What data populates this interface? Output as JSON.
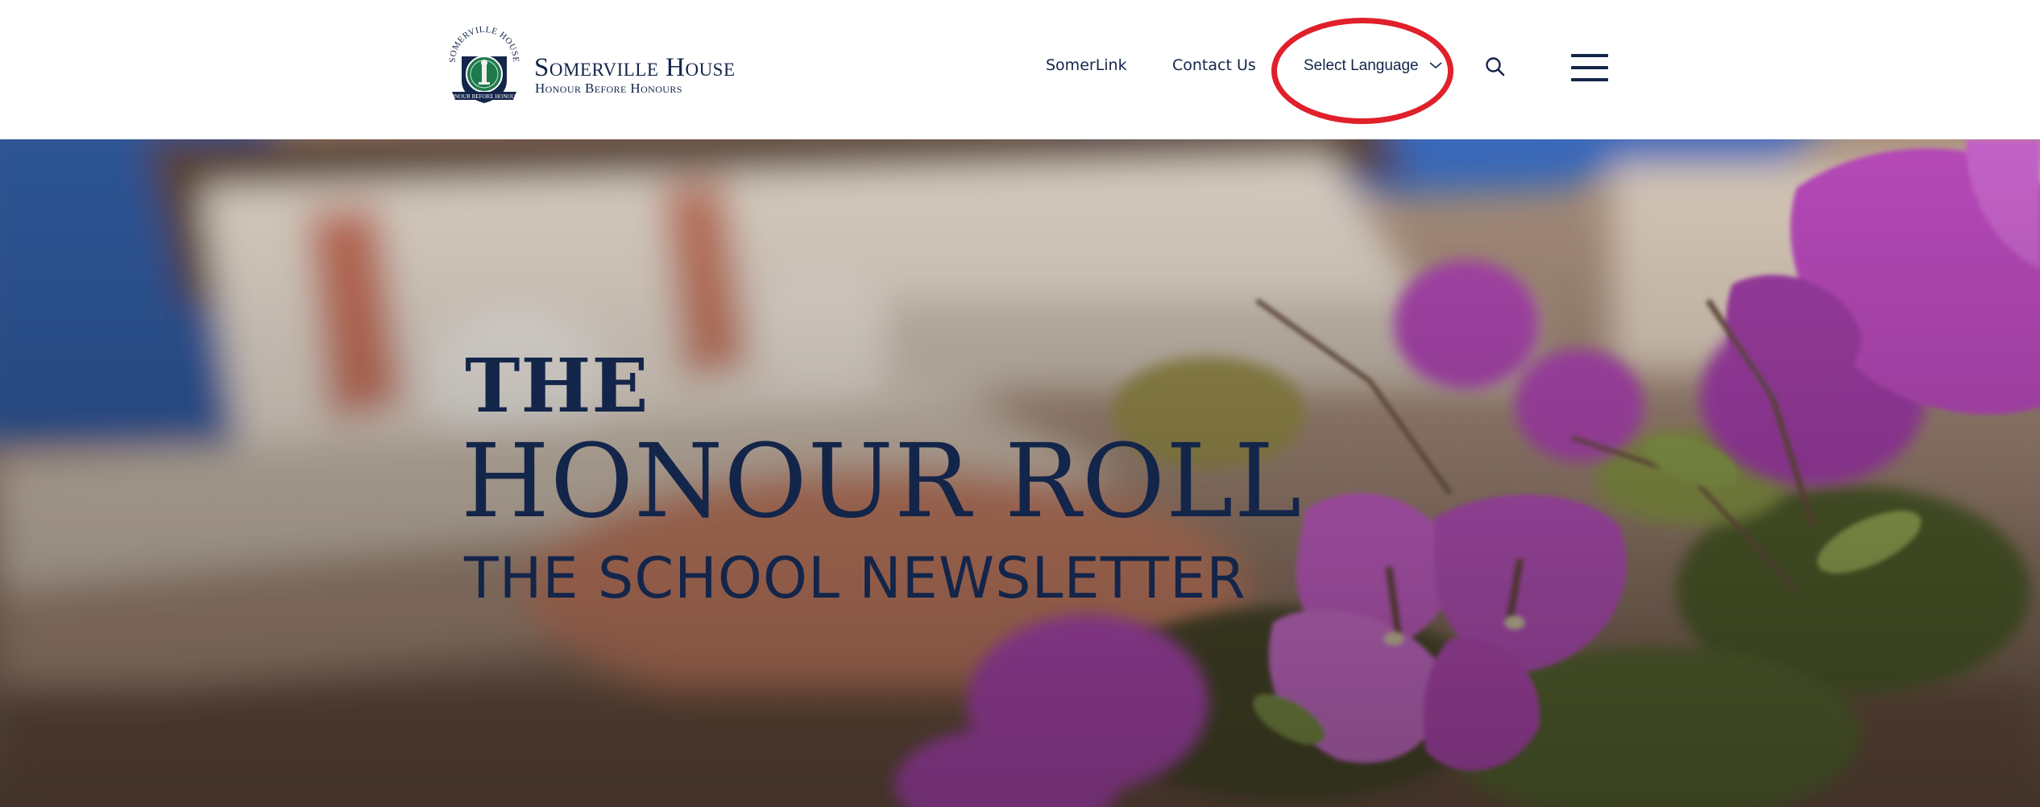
{
  "header": {
    "brand": {
      "name": "Somerville House",
      "motto": "Honour Before Honours",
      "crest_top_text": "SOMERVILLE HOUSE",
      "crest_bottom_text": "HONOUR BEFORE HONOURS"
    },
    "nav": {
      "somerlink_label": "SomerLink",
      "contact_label": "Contact Us",
      "language_label": "Select Language"
    },
    "icons": {
      "search": "search-icon",
      "menu": "hamburger-menu-icon",
      "language_dropdown": "chevron-down-icon"
    },
    "annotation": {
      "shape": "ellipse",
      "color": "#e0202a",
      "target": "language-select"
    }
  },
  "hero": {
    "kicker": "THE",
    "title": "HONOUR ROLL",
    "subtitle": "THE SCHOOL NEWSLETTER"
  },
  "colors": {
    "brand_navy": "#14254a",
    "annotation_red": "#e0202a",
    "crest_green": "#1f7a4b"
  }
}
